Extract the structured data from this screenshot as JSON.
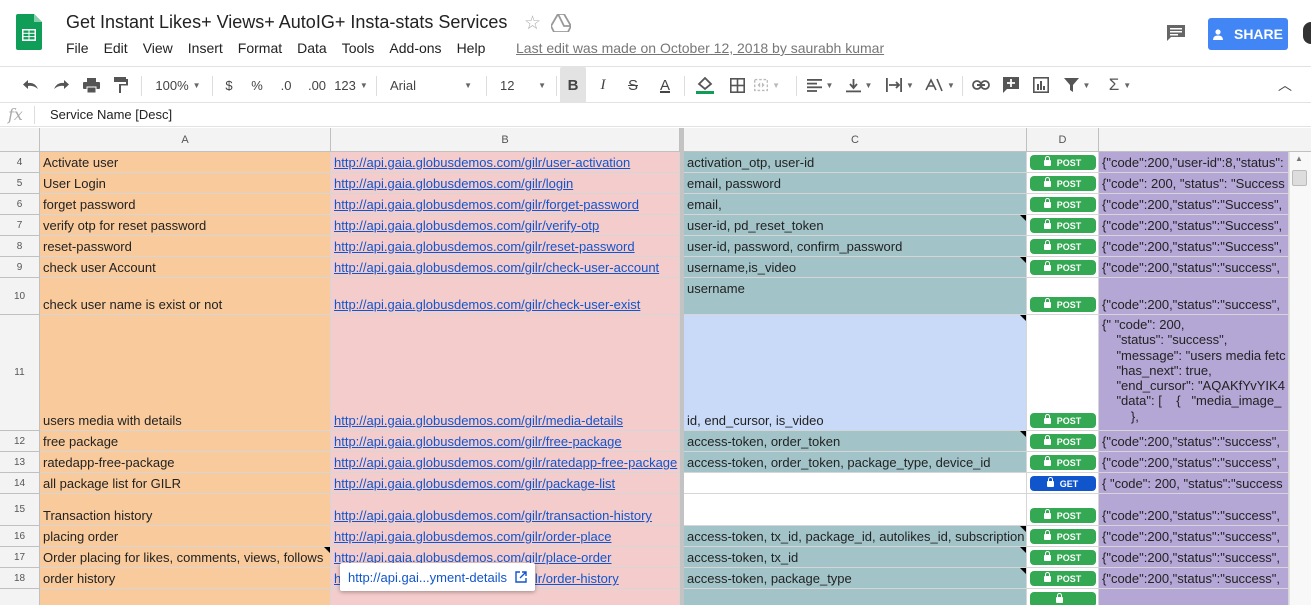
{
  "doc": {
    "title": "Get Instant Likes+ Views+ AutoIG+ Insta-stats Services",
    "last_edit": "Last edit was made on October 12, 2018 by saurabh kumar",
    "share_label": "SHARE"
  },
  "menu": [
    "File",
    "Edit",
    "View",
    "Insert",
    "Format",
    "Data",
    "Tools",
    "Add-ons",
    "Help"
  ],
  "toolbar": {
    "zoom": "100%",
    "currency": "$",
    "percent": "%",
    "dec_less": ".0",
    "dec_more": ".00",
    "more_formats": "123",
    "font": "Arial",
    "font_size": "12",
    "bold": "B",
    "italic": "I",
    "strike": "S",
    "text_color": "A"
  },
  "formula": {
    "fx": "fx",
    "value": "Service Name [Desc]"
  },
  "columns": [
    "A",
    "B",
    "C",
    "D"
  ],
  "rows": [
    {
      "num": "4",
      "a": "Activate user",
      "b": "http://api.gaia.globusdemos.com/gilr/user-activation",
      "c": "activation_otp, user-id",
      "d": "POST",
      "e": "{\"code\":200,\"user-id\":8,\"status\":"
    },
    {
      "num": "5",
      "a": "User Login",
      "b": "http://api.gaia.globusdemos.com/gilr/login",
      "c": "email, password",
      "d": "POST",
      "e": "{\"code\": 200, \"status\": \"Success"
    },
    {
      "num": "6",
      "a": "forget password",
      "b": "http://api.gaia.globusdemos.com/gilr/forget-password",
      "c": "email,",
      "d": "POST",
      "e": "{\"code\":200,\"status\":\"Success\","
    },
    {
      "num": "7",
      "a": "verify otp for reset password",
      "b": "http://api.gaia.globusdemos.com/gilr/verify-otp",
      "c": "user-id, pd_reset_token",
      "d": "POST",
      "e": "{\"code\":200,\"status\":\"Success\","
    },
    {
      "num": "8",
      "a": "reset-password",
      "b": "http://api.gaia.globusdemos.com/gilr/reset-password",
      "c": "user-id, password, confirm_password",
      "d": "POST",
      "e": "{\"code\":200,\"status\":\"Success\","
    },
    {
      "num": "9",
      "a": "check user Account",
      "b": "http://api.gaia.globusdemos.com/gilr/check-user-account",
      "c": "username,is_video",
      "d": "POST",
      "e": "{\"code\":200,\"status\":\"success\","
    },
    {
      "num": "10",
      "a": "check user name is exist or not",
      "b": "http://api.gaia.globusdemos.com/gilr/check-user-exist",
      "c": "username",
      "d": "POST",
      "e": "{\"code\":200,\"status\":\"success\","
    },
    {
      "num": "11",
      "a": "users media with details",
      "b": "http://api.gaia.globusdemos.com/gilr/media-details",
      "c": "id, end_cursor, is_video",
      "d": "POST",
      "e": "{\" \"code\": 200,\n    \"status\": \"success\",\n    \"message\": \"users media fetc\n    \"has_next\": true,\n    \"end_cursor\": \"AQAKfYvYIK4\n    \"data\": [    {   \"media_image_\n        },"
    },
    {
      "num": "12",
      "a": "free package",
      "b": "http://api.gaia.globusdemos.com/gilr/free-package",
      "c": "access-token, order_token",
      "d": "POST",
      "e": "{\"code\":200,\"status\":\"success\","
    },
    {
      "num": "13",
      "a": "ratedapp-free-package",
      "b": "http://api.gaia.globusdemos.com/gilr/ratedapp-free-package",
      "c": "access-token, order_token, package_type, device_id",
      "d": "POST",
      "e": "{\"code\":200,\"status\":\"success\","
    },
    {
      "num": "14",
      "a": "all package list for GILR",
      "b": "http://api.gaia.globusdemos.com/gilr/package-list",
      "c": "",
      "d": "GET",
      "e": "{ \"code\": 200, \"status\":\"success"
    },
    {
      "num": "15",
      "a": "Transaction history",
      "b": "http://api.gaia.globusdemos.com/gilr/transaction-history",
      "c": "",
      "d": "POST",
      "e": "{\"code\":200,\"status\":\"success\","
    },
    {
      "num": "16",
      "a": "placing order",
      "b": "http://api.gaia.globusdemos.com/gilr/order-place",
      "c": "access-token, tx_id, package_id, autolikes_id, subscription",
      "d": "POST",
      "e": "{\"code\":200,\"status\":\"success\","
    },
    {
      "num": "17",
      "a": "Order placing for likes, comments, views, follows",
      "b": "http://api.gaia.globusdemos.com/gilr/place-order",
      "c": "access-token, tx_id",
      "d": "POST",
      "e": "{\"code\":200,\"status\":\"success\","
    },
    {
      "num": "18",
      "a": "order history",
      "b": "http://api.gaia.globusdemos.com/gilr/order-history",
      "c": "access-token, package_type",
      "d": "POST",
      "e": "{\"code\":200,\"status\":\"success\","
    }
  ],
  "tooltip": {
    "text": "http://api.gai...yment-details"
  },
  "colors": {
    "col_a": "#f9cb9c",
    "col_b": "#f4cccc",
    "col_c": "#a2c4c9",
    "col_e": "#b4a7d6",
    "post": "#34a853",
    "get": "#1155cc",
    "share": "#4285f4"
  }
}
